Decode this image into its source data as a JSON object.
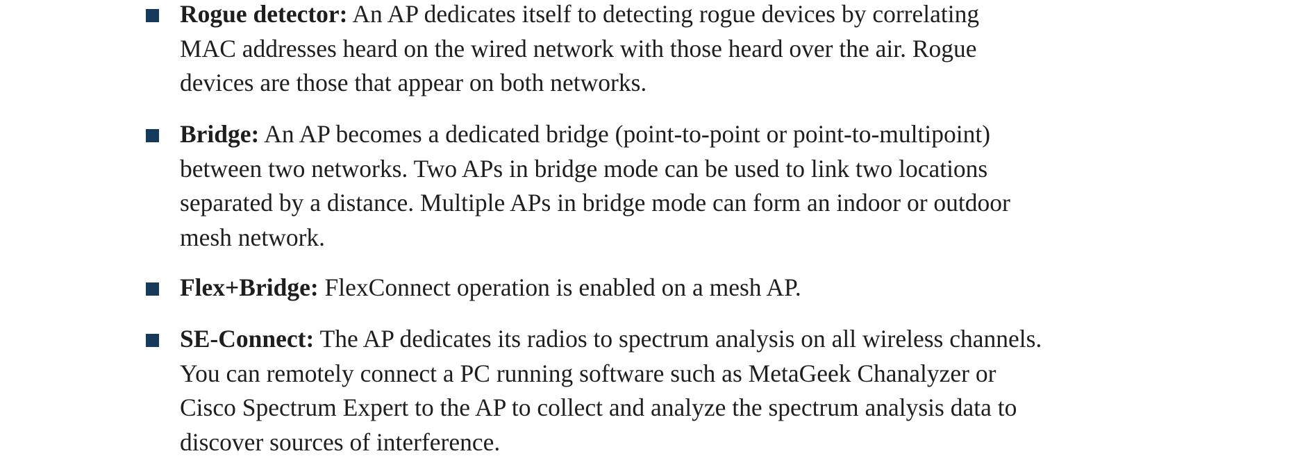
{
  "items": [
    {
      "term": "Rogue detector:",
      "lines": [
        " An AP dedicates itself to detecting rogue devices by correlating",
        "MAC addresses heard on the wired network with those heard over the air. Rogue",
        "devices are those that appear on both networks."
      ]
    },
    {
      "term": "Bridge:",
      "lines": [
        " An AP becomes a dedicated bridge (point-to-point or point-to-multipoint)",
        "between two networks. Two APs in bridge mode can be used to link two locations",
        "separated by a distance. Multiple APs in bridge mode can form an indoor or outdoor",
        "mesh network."
      ]
    },
    {
      "term": "Flex+Bridge:",
      "lines": [
        " FlexConnect operation is enabled on a mesh AP."
      ]
    },
    {
      "term": "SE-Connect:",
      "lines": [
        " The AP dedicates its radios to spectrum analysis on all wireless channels.",
        "You can remotely connect a PC running software such as MetaGeek Chanalyzer or",
        "Cisco Spectrum Expert to the AP to collect and analyze the spectrum analysis data to",
        "discover sources of interference."
      ]
    }
  ],
  "colors": {
    "bullet": "#163a5c",
    "text": "#1e1e1e",
    "background": "#ffffff"
  },
  "icons": {
    "bullet": "square-bullet-icon"
  }
}
